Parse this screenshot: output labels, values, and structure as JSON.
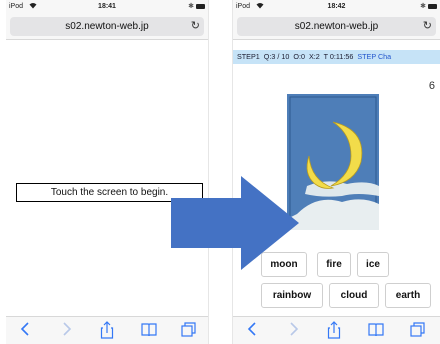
{
  "left_phone": {
    "status": {
      "carrier": "iPod",
      "time": "18:41"
    },
    "url": "s02.newton-web.jp",
    "message": "Touch the screen to begin."
  },
  "right_phone": {
    "status": {
      "carrier": "iPod",
      "time": "18:42"
    },
    "url": "s02.newton-web.jp",
    "step_bar": {
      "step": "STEP1",
      "question": "Q:3 / 10",
      "correct": "O:0",
      "wrong": "X:2",
      "time": "T 0:11:56",
      "challenge": "STEP Cha"
    },
    "page_number": "6",
    "choices": [
      "moon",
      "fire",
      "ice",
      "rainbow",
      "cloud",
      "earth"
    ]
  },
  "icons": {
    "reload": "reload-icon",
    "back": "chevron-left-icon",
    "forward": "chevron-right-icon",
    "share": "share-icon",
    "bookmarks": "book-icon",
    "tabs": "tabs-icon",
    "arrow": "right-arrow-icon"
  },
  "colors": {
    "arrow": "#4472c4",
    "step_bar": "#c6e3f7",
    "toolbar_icons": "#3478f6"
  }
}
